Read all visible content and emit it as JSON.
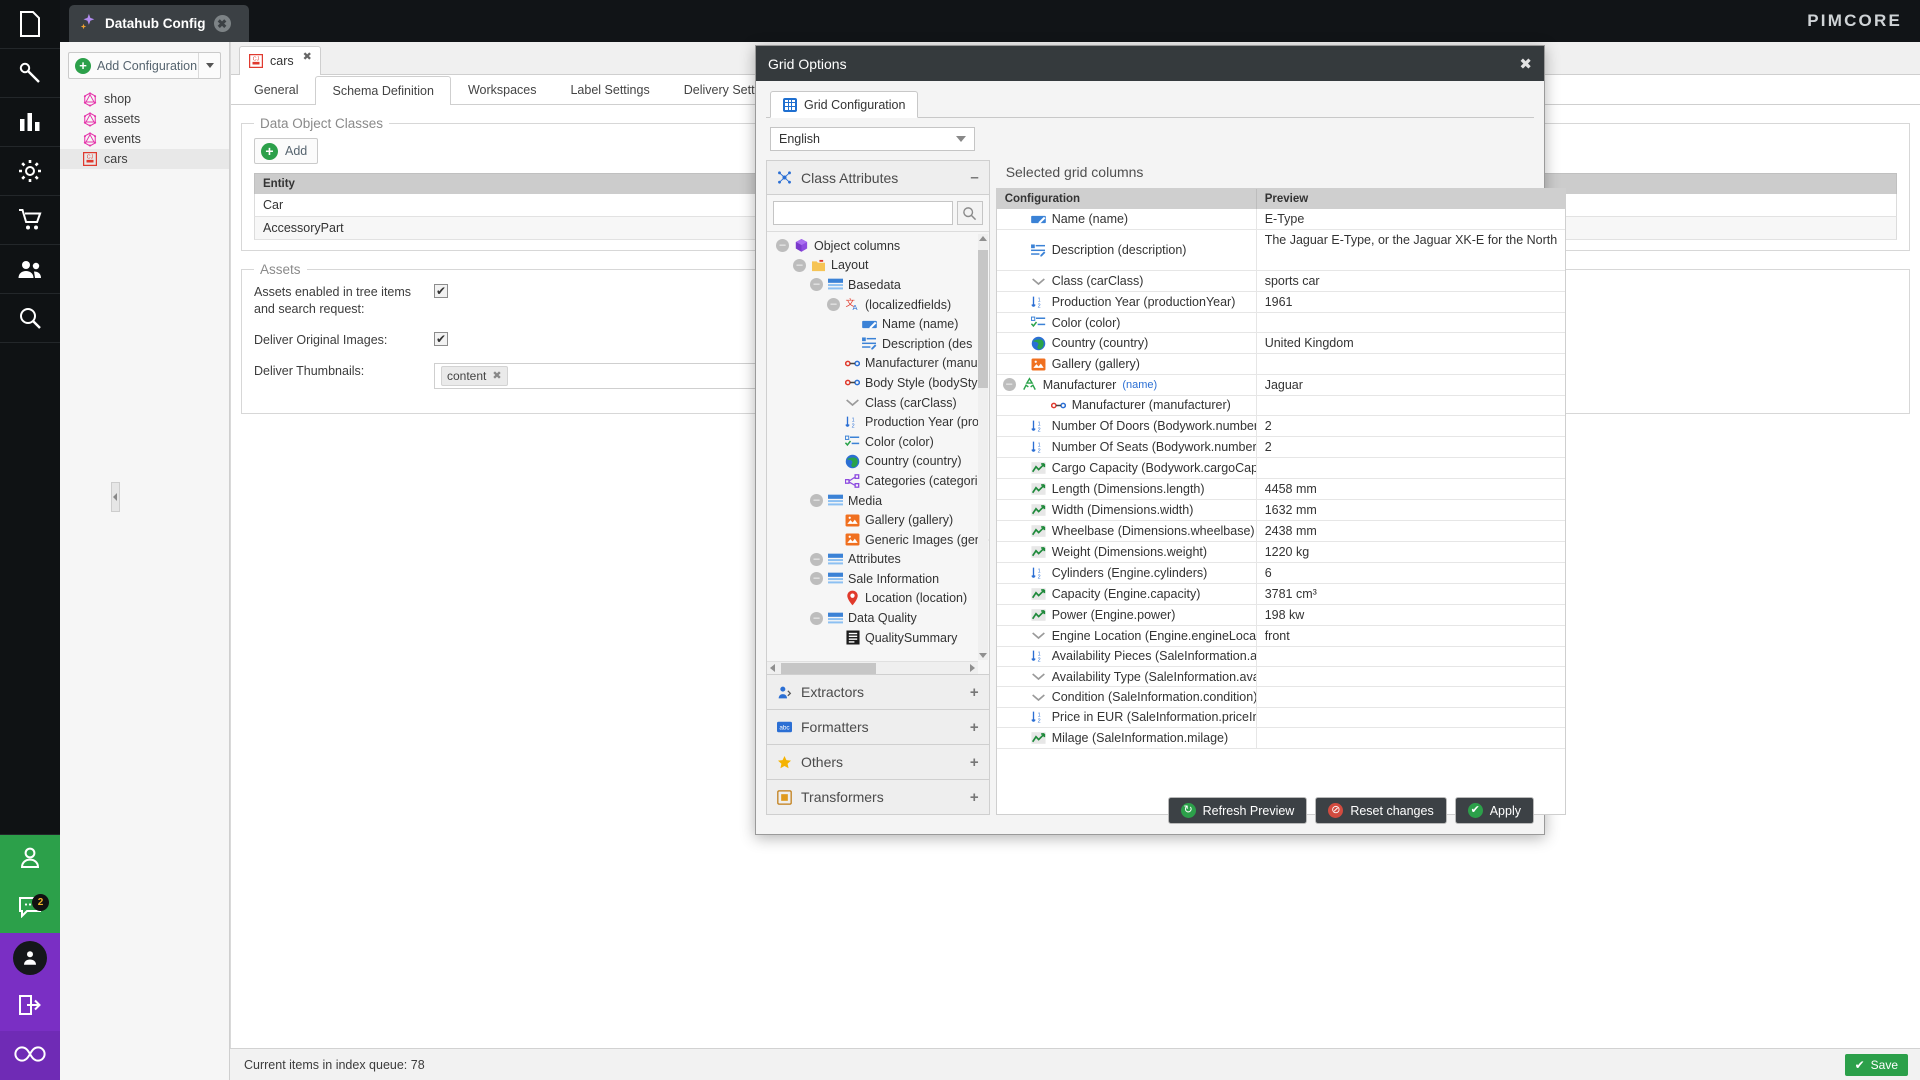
{
  "topbar": {
    "brand": "PIMCORE",
    "window_tab_title": "Datahub Config",
    "close_glyph": "✖"
  },
  "leftnav": {
    "items": [
      {
        "name": "documents-icon"
      },
      {
        "name": "tools-icon"
      },
      {
        "name": "reports-icon"
      },
      {
        "name": "settings-icon"
      },
      {
        "name": "ecommerce-icon"
      },
      {
        "name": "customers-icon"
      },
      {
        "name": "search-icon"
      }
    ],
    "bottom": [
      {
        "name": "profile-icon",
        "badge": ""
      },
      {
        "name": "notifications-icon",
        "badge": "2"
      },
      {
        "name": "user-avatar-icon",
        "badge": ""
      },
      {
        "name": "logout-icon",
        "badge": ""
      },
      {
        "name": "infinity-icon",
        "badge": ""
      }
    ]
  },
  "sidebar": {
    "add_configuration_label": "Add Configuration",
    "items": [
      {
        "label": "shop",
        "icon": "graphql-icon",
        "selected": false
      },
      {
        "label": "assets",
        "icon": "graphql-icon",
        "selected": false
      },
      {
        "label": "events",
        "icon": "graphql-icon",
        "selected": false
      },
      {
        "label": "cars",
        "icon": "cjhub-icon",
        "selected": true
      }
    ]
  },
  "editor": {
    "doc_tab_label": "cars",
    "tabs": [
      {
        "label": "General",
        "active": false
      },
      {
        "label": "Schema Definition",
        "active": true
      },
      {
        "label": "Workspaces",
        "active": false
      },
      {
        "label": "Label Settings",
        "active": false
      },
      {
        "label": "Delivery Settings",
        "active": false
      }
    ],
    "data_object_classes": {
      "legend": "Data Object Classes",
      "add_label": "Add",
      "column_header": "Entity",
      "rows": [
        "Car",
        "AccessoryPart"
      ]
    },
    "assets": {
      "legend": "Assets",
      "fields": [
        {
          "label": "Assets enabled in tree items and search request:",
          "type": "checkbox",
          "checked": true
        },
        {
          "label": "Deliver Original Images:",
          "type": "checkbox",
          "checked": true
        },
        {
          "label": "Deliver Thumbnails:",
          "type": "tags",
          "tags": [
            "content"
          ]
        }
      ]
    }
  },
  "statusbar": {
    "text": "Current items in index queue: 78",
    "save_label": "Save"
  },
  "modal": {
    "title": "Grid Options",
    "close_glyph": "✖",
    "tab_label": "Grid Configuration",
    "language": "English",
    "class_attributes": {
      "title": "Class Attributes",
      "collapse_sign": "–",
      "search_placeholder": "",
      "search_value": "",
      "tree": [
        {
          "depth": 0,
          "label": "Object columns",
          "icon": "cube-icon",
          "expander": "minus"
        },
        {
          "depth": 1,
          "label": "Layout",
          "icon": "folder-icon",
          "expander": "minus"
        },
        {
          "depth": 2,
          "label": "Basedata",
          "icon": "panel-icon",
          "expander": "minus"
        },
        {
          "depth": 3,
          "label": "(localizedfields)",
          "icon": "localized-icon",
          "expander": "minus"
        },
        {
          "depth": 4,
          "label": "Name (name)",
          "icon": "input-icon",
          "expander": "none"
        },
        {
          "depth": 4,
          "label": "Description (des",
          "icon": "textarea-icon",
          "expander": "none"
        },
        {
          "depth": 3,
          "label": "Manufacturer (manu",
          "icon": "relation-icon",
          "expander": "none"
        },
        {
          "depth": 3,
          "label": "Body Style (bodyStyle",
          "icon": "relation-icon",
          "expander": "none"
        },
        {
          "depth": 3,
          "label": "Class (carClass)",
          "icon": "select-icon",
          "expander": "none"
        },
        {
          "depth": 3,
          "label": "Production Year (pro",
          "icon": "number-icon",
          "expander": "none"
        },
        {
          "depth": 3,
          "label": "Color (color)",
          "icon": "multiselect-icon",
          "expander": "none"
        },
        {
          "depth": 3,
          "label": "Country (country)",
          "icon": "globe-icon",
          "expander": "none"
        },
        {
          "depth": 3,
          "label": "Categories (categorie",
          "icon": "share-icon",
          "expander": "none"
        },
        {
          "depth": 2,
          "label": "Media",
          "icon": "panel-icon",
          "expander": "minus"
        },
        {
          "depth": 3,
          "label": "Gallery (gallery)",
          "icon": "image-icon",
          "expander": "none"
        },
        {
          "depth": 3,
          "label": "Generic Images (gene",
          "icon": "image-icon",
          "expander": "none"
        },
        {
          "depth": 2,
          "label": "Attributes",
          "icon": "panel-icon",
          "expander": "minus"
        },
        {
          "depth": 2,
          "label": "Sale Information",
          "icon": "panel-icon",
          "expander": "minus"
        },
        {
          "depth": 3,
          "label": "Location (location)",
          "icon": "pin-icon",
          "expander": "none"
        },
        {
          "depth": 2,
          "label": "Data Quality",
          "icon": "panel-icon",
          "expander": "minus"
        },
        {
          "depth": 3,
          "label": "QualitySummary",
          "icon": "document-icon",
          "expander": "none"
        }
      ]
    },
    "accordions": [
      {
        "label": "Extractors",
        "icon": "extractor-icon",
        "sign": "+"
      },
      {
        "label": "Formatters",
        "icon": "abc-icon",
        "sign": "+"
      },
      {
        "label": "Others",
        "icon": "star-icon",
        "sign": "+"
      },
      {
        "label": "Transformers",
        "icon": "transformer-icon",
        "sign": "+"
      }
    ],
    "selected_grid": {
      "title": "Selected grid columns",
      "headers": [
        "Configuration",
        "Preview"
      ],
      "rows": [
        {
          "icon": "input-icon",
          "label": "Name (name)",
          "preview": "E-Type",
          "indent": 1,
          "tall": false
        },
        {
          "icon": "textarea-icon",
          "label": "Description (description)",
          "preview": "The Jaguar E-Type, or the Jaguar XK-E for the North",
          "indent": 1,
          "tall": true
        },
        {
          "icon": "select-icon",
          "label": "Class (carClass)",
          "preview": "sports car",
          "indent": 1,
          "tall": false
        },
        {
          "icon": "number-icon",
          "label": "Production Year (productionYear)",
          "preview": "1961",
          "indent": 1,
          "tall": false
        },
        {
          "icon": "multiselect-icon",
          "label": "Color (color)",
          "preview": "",
          "indent": 1,
          "tall": false
        },
        {
          "icon": "globe-icon",
          "label": "Country (country)",
          "preview": "United Kingdom",
          "indent": 1,
          "tall": false
        },
        {
          "icon": "image-icon",
          "label": "Gallery (gallery)",
          "preview": "",
          "indent": 1,
          "tall": false
        },
        {
          "icon": "recycle-icon",
          "label": "Manufacturer",
          "sub": "(name)",
          "preview": "Jaguar",
          "indent": 0,
          "expander": "minus",
          "tall": false
        },
        {
          "icon": "relation-icon",
          "label": "Manufacturer (manufacturer)",
          "preview": "",
          "indent": 2,
          "tall": false
        },
        {
          "icon": "number-icon",
          "label": "Number Of Doors (Bodywork.numberOf...",
          "preview": "2",
          "indent": 1,
          "tall": false
        },
        {
          "icon": "number-icon",
          "label": "Number Of Seats (Bodywork.numberOf...",
          "preview": "2",
          "indent": 1,
          "tall": false
        },
        {
          "icon": "quantity-icon",
          "label": "Cargo Capacity (Bodywork.cargoCapacity)",
          "preview": "",
          "indent": 1,
          "tall": false
        },
        {
          "icon": "quantity-icon",
          "label": "Length (Dimensions.length)",
          "preview": "4458 mm",
          "indent": 1,
          "tall": false
        },
        {
          "icon": "quantity-icon",
          "label": "Width (Dimensions.width)",
          "preview": "1632 mm",
          "indent": 1,
          "tall": false
        },
        {
          "icon": "quantity-icon",
          "label": "Wheelbase (Dimensions.wheelbase)",
          "preview": "2438 mm",
          "indent": 1,
          "tall": false
        },
        {
          "icon": "quantity-icon",
          "label": "Weight (Dimensions.weight)",
          "preview": "1220 kg",
          "indent": 1,
          "tall": false
        },
        {
          "icon": "number-icon",
          "label": "Cylinders (Engine.cylinders)",
          "preview": "6",
          "indent": 1,
          "tall": false
        },
        {
          "icon": "quantity-icon",
          "label": "Capacity (Engine.capacity)",
          "preview": "3781 cm³",
          "indent": 1,
          "tall": false
        },
        {
          "icon": "quantity-icon",
          "label": "Power (Engine.power)",
          "preview": "198 kw",
          "indent": 1,
          "tall": false
        },
        {
          "icon": "select-icon",
          "label": "Engine Location (Engine.engineLocation)",
          "preview": "front",
          "indent": 1,
          "tall": false
        },
        {
          "icon": "number-icon",
          "label": "Availability Pieces (SaleInformation.avail...",
          "preview": "",
          "indent": 1,
          "tall": false
        },
        {
          "icon": "select-icon",
          "label": "Availability Type (SaleInformation.availa...",
          "preview": "",
          "indent": 1,
          "tall": false
        },
        {
          "icon": "select-icon",
          "label": "Condition (SaleInformation.condition)",
          "preview": "",
          "indent": 1,
          "tall": false
        },
        {
          "icon": "number-icon",
          "label": "Price in EUR (SaleInformation.priceInEUR)",
          "preview": "",
          "indent": 1,
          "tall": false
        },
        {
          "icon": "quantity-icon",
          "label": "Milage (SaleInformation.milage)",
          "preview": "",
          "indent": 1,
          "tall": false
        }
      ]
    },
    "footer_buttons": [
      {
        "label": "Refresh Preview",
        "icon": "refresh-icon",
        "color": "#2ca04a"
      },
      {
        "label": "Reset changes",
        "icon": "reset-icon",
        "color": "#d24b3f"
      },
      {
        "label": "Apply",
        "icon": "check-icon",
        "color": "#2ca04a"
      }
    ]
  }
}
